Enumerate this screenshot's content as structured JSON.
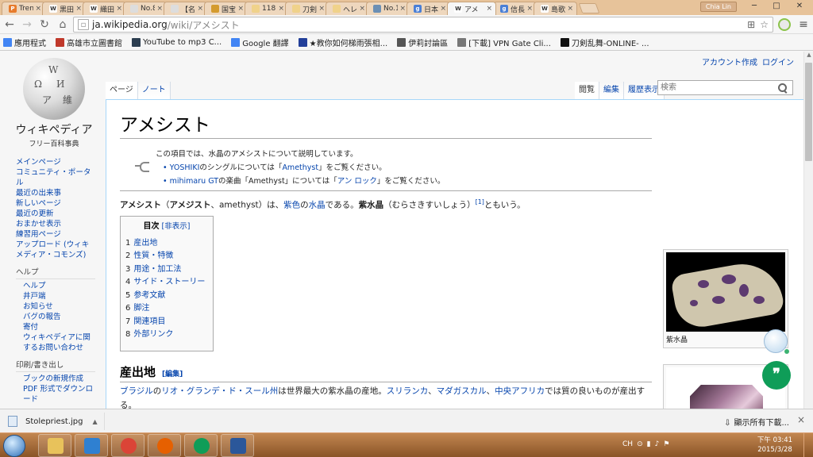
{
  "browser": {
    "tabs": [
      {
        "label": "Trend",
        "favicon": "orange-square-icon",
        "color": "#e77b2c",
        "glyph": "P"
      },
      {
        "label": "黒田",
        "favicon": "wikipedia-w-icon",
        "color": "#ffffff",
        "glyph": "W"
      },
      {
        "label": "織田",
        "favicon": "wikipedia-w-icon",
        "color": "#ffffff",
        "glyph": "W"
      },
      {
        "label": "No.8",
        "favicon": "page-icon",
        "color": "#dddddd",
        "glyph": ""
      },
      {
        "label": "【名",
        "favicon": "page-icon",
        "color": "#dddddd",
        "glyph": ""
      },
      {
        "label": "国宝",
        "favicon": "game-icon",
        "color": "#d49b2f",
        "glyph": ""
      },
      {
        "label": "118",
        "favicon": "cat-icon",
        "color": "#f0d28a",
        "glyph": ""
      },
      {
        "label": "刀剣",
        "favicon": "cat-icon",
        "color": "#f0d28a",
        "glyph": ""
      },
      {
        "label": "ヘレ",
        "favicon": "cat-icon",
        "color": "#f0d28a",
        "glyph": ""
      },
      {
        "label": "No.1",
        "favicon": "plane-icon",
        "color": "#6b8fb4",
        "glyph": ""
      },
      {
        "label": "日本",
        "favicon": "google-icon",
        "color": "#4a7fd6",
        "glyph": "g"
      },
      {
        "label": "アメ",
        "favicon": "wikipedia-w-icon",
        "color": "#ffffff",
        "glyph": "W",
        "active": true
      },
      {
        "label": "信長",
        "favicon": "google-icon",
        "color": "#4a7fd6",
        "glyph": "g"
      },
      {
        "label": "島歌",
        "favicon": "wikipedia-w-icon",
        "color": "#ffffff",
        "glyph": "W"
      }
    ],
    "user_badge": "Chia Lin",
    "close_glyph": "×",
    "window": {
      "minimize": "─",
      "maximize": "□",
      "close": "✕"
    },
    "url_host": "ja.wikipedia.org",
    "url_path": "/wiki/アメシスト",
    "bookmarks": [
      {
        "label": "應用程式",
        "icon": "apps-grid-icon",
        "color": "#4285f4"
      },
      {
        "label": "高雄市立圖書館",
        "icon": "library-icon",
        "color": "#c0392b"
      },
      {
        "label": "YouTube to mp3 C...",
        "icon": "music-icon",
        "color": "#2c3e50"
      },
      {
        "label": "Google 翻譯",
        "icon": "google-translate-icon",
        "color": "#4285f4"
      },
      {
        "label": "★教你如何梯雨張相...",
        "icon": "bookmark-icon",
        "color": "#223f99"
      },
      {
        "label": "伊莉討論區",
        "icon": "forum-icon",
        "color": "#555555"
      },
      {
        "label": "[下載] VPN Gate Cli...",
        "icon": "page-icon",
        "color": "#777777"
      },
      {
        "label": "刀剣乱舞-ONLINE- ...",
        "icon": "d-letter-icon",
        "color": "#111111"
      }
    ]
  },
  "wiki": {
    "personal": {
      "create": "アカウント作成",
      "login": "ログイン"
    },
    "logo": {
      "wordmark": "ウィキペディア",
      "tagline": "フリー百科事典"
    },
    "nav": [
      "メインページ",
      "コミュニティ・ポータル",
      "最近の出来事",
      "新しいページ",
      "最近の更新",
      "おまかせ表示",
      "練習用ページ",
      "アップロード (ウィキメディア・コモンズ)"
    ],
    "help_heading": "ヘルプ",
    "help_links": [
      "ヘルプ",
      "井戸端",
      "お知らせ",
      "バグの報告",
      "寄付",
      "ウィキペディアに関するお問い合わせ"
    ],
    "print_heading": "印刷/書き出し",
    "print_links": [
      "ブックの新規作成",
      "PDF 形式でダウンロード"
    ],
    "tabs_left": [
      "ページ",
      "ノート"
    ],
    "tabs_right": [
      "閲覧",
      "編集",
      "履歴表示"
    ],
    "search_placeholder": "検索",
    "title": "アメシスト",
    "hatnote": {
      "lead": "この項目では、水晶のアメシストについて説明しています。",
      "items": [
        {
          "pre": "",
          "link1": "YOSHIKI",
          "mid": "のシングルについては「",
          "link2": "Amethyst",
          "post": "」をご覧ください。"
        },
        {
          "pre": "",
          "link1": "mihimaru GT",
          "mid": "の楽曲「Amethyst」については「",
          "link2": "アン ロック",
          "post": "」をご覧ください。"
        }
      ]
    },
    "intro": {
      "bold1": "アメシスト",
      "paren_open": "（",
      "bold2": "アメジスト",
      "t1": "、amethyst）は、",
      "link1": "紫色",
      "t2": "の",
      "link2": "水晶",
      "t3": "である。",
      "bold3": "紫水晶",
      "t4": "（むらさきすいしょう）",
      "ref": "[1]",
      "t5": "ともいう。"
    },
    "toc": {
      "title": "目次",
      "toggle": "[非表示]",
      "items": [
        {
          "num": "1",
          "label": "産出地"
        },
        {
          "num": "2",
          "label": "性質・特徴"
        },
        {
          "num": "3",
          "label": "用途・加工法"
        },
        {
          "num": "4",
          "label": "サイド・ストーリー"
        },
        {
          "num": "5",
          "label": "参考文献"
        },
        {
          "num": "6",
          "label": "脚注"
        },
        {
          "num": "7",
          "label": "関連項目"
        },
        {
          "num": "8",
          "label": "外部リンク"
        }
      ]
    },
    "section1": {
      "heading": "産出地",
      "edit": "[編集]",
      "link1": "ブラジル",
      "t1": "の",
      "link2": "リオ・グランデ・ド・スール州",
      "t2": "は世界最大の紫水晶の産地。",
      "link3": "スリランカ",
      "sep1": "、",
      "link4": "マダガスカル",
      "sep2": "、",
      "link5": "中央アフリカ",
      "t3": "では質の良いものが産出する。"
    },
    "thumb1_caption": "紫水晶"
  },
  "download": {
    "file": "Stolepriest.jpg",
    "show_all": "顯示所有下載..."
  },
  "taskbar": {
    "lang": "CH",
    "time": "下午 03:41",
    "date": "2015/3/28",
    "apps": [
      {
        "name": "file-explorer-icon",
        "color": "#e8c25b"
      },
      {
        "name": "media-player-icon",
        "color": "#2f80d1"
      },
      {
        "name": "chrome-icon",
        "color": "#db4437"
      },
      {
        "name": "firefox-icon",
        "color": "#e66000"
      },
      {
        "name": "hangouts-icon",
        "color": "#0f9d58"
      },
      {
        "name": "word-icon",
        "color": "#2b579a"
      }
    ]
  }
}
